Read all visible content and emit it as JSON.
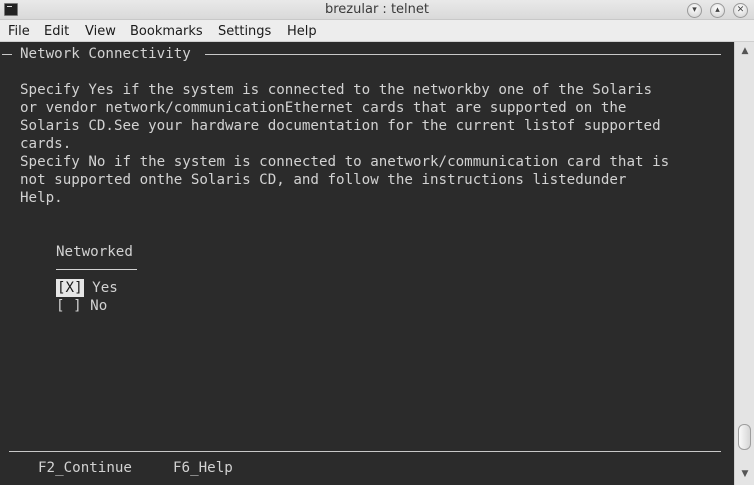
{
  "window": {
    "title": "brezular : telnet",
    "controls": {
      "minimize": "▾",
      "maximize": "▴",
      "close": "✕"
    }
  },
  "menu": {
    "items": [
      "File",
      "Edit",
      "View",
      "Bookmarks",
      "Settings",
      "Help"
    ]
  },
  "terminal": {
    "section_title": "Network Connectivity",
    "paragraph_lines": [
      "Specify Yes if the system is connected to the networkby one of the Solaris",
      "or vendor network/communicationEthernet cards that are supported on the",
      "Solaris CD.See your hardware documentation for the current listof supported",
      "cards.",
      "Specify No if the system is connected to anetwork/communication card that is",
      "not supported onthe Solaris CD, and follow the instructions listedunder",
      "Help."
    ],
    "field_label": "Networked",
    "options": [
      {
        "box": "[X]",
        "label": "Yes",
        "selected": true
      },
      {
        "box": "[ ]",
        "label": "No",
        "selected": false
      }
    ],
    "footer_keys": [
      "F2_Continue",
      "F6_Help"
    ]
  },
  "scrollbar": {
    "up_icon": "▲",
    "down_icon": "▼"
  }
}
